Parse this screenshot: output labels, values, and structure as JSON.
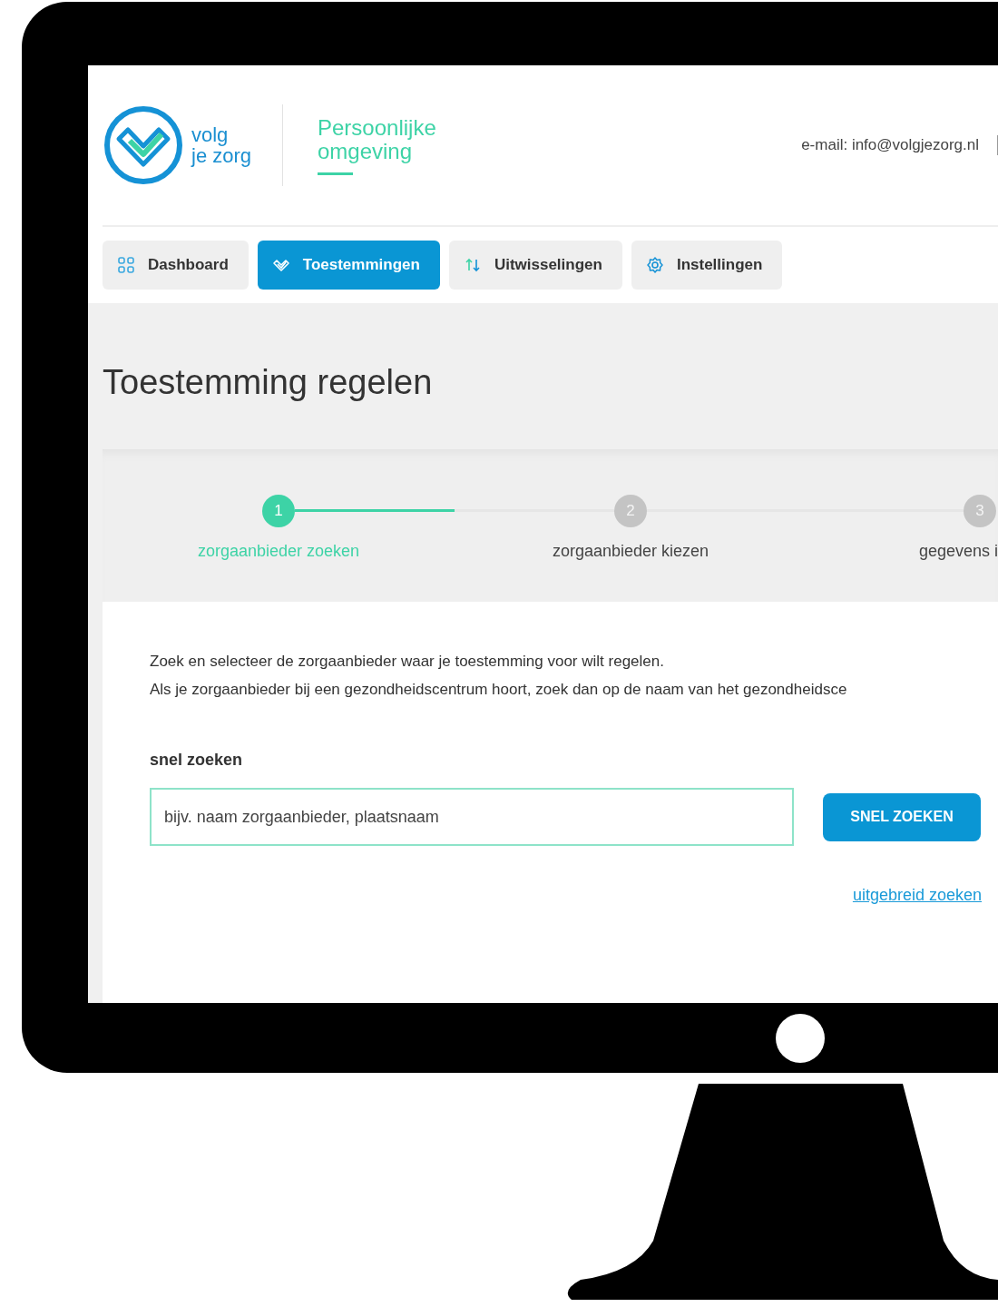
{
  "header": {
    "brand": "volg\nje zorg",
    "section": "Persoonlijke omgeving",
    "contact": "e-mail: info@volgjezorg.nl"
  },
  "tabs": [
    {
      "label": "Dashboard",
      "kind": "grid",
      "selected": false
    },
    {
      "label": "Toestemmingen",
      "kind": "check",
      "selected": true
    },
    {
      "label": "Uitwisselingen",
      "kind": "arrows",
      "selected": false
    },
    {
      "label": "Instellingen",
      "kind": "gear",
      "selected": false
    }
  ],
  "page_title": "Toestemming regelen",
  "stepper": {
    "steps": [
      {
        "number": "1",
        "label": "zorgaanbieder zoeken",
        "selected": true,
        "level": 0.5
      },
      {
        "number": "2",
        "label": "zorgaanbieder kiezen",
        "selected": false
      },
      {
        "number": "3",
        "label": "gegevens i",
        "selected": false
      }
    ]
  },
  "intro": [
    "Zoek en selecteer de zorgaanbieder waar je toestemming voor wilt regelen.",
    "Als je zorgaanbieder bij een gezondheidscentrum hoort, zoek dan op de naam van het gezondheidsce"
  ],
  "search": {
    "label": "snel zoeken",
    "placeholder": "bijv. naam zorgaanbieder, plaatsnaam",
    "button": "SNEL ZOEKEN",
    "advanced_link": "uitgebreid zoeken"
  }
}
